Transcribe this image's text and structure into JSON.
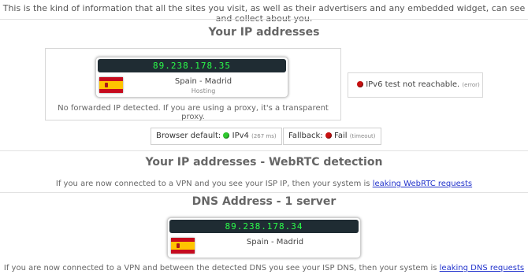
{
  "intro": "This is the kind of information that all the sites you visit, as well as their advertisers and any embedded widget, can see and collect about you.",
  "ip_section": {
    "title": "Your IP addresses",
    "ip": "89.238.178.35",
    "location": "Spain - Madrid",
    "type": "Hosting",
    "proxy_note": "No forwarded IP detected. If you are using a proxy, it's a transparent proxy.",
    "ipv6_text": "IPv6 test not reachable.",
    "ipv6_suffix": "(error)",
    "browser_default_label": "Browser default:",
    "browser_default_value": "IPv4",
    "browser_default_time": "(267 ms)",
    "fallback_label": "Fallback:",
    "fallback_value": "Fail",
    "fallback_time": "(timeout)"
  },
  "webrtc_section": {
    "title": "Your IP addresses - WebRTC detection",
    "text": "If you are now connected to a VPN and you see your ISP IP, then your system is",
    "link": "leaking WebRTC requests"
  },
  "dns_section": {
    "title": "DNS Address - 1 server",
    "ip": "89.238.178.34",
    "location": "Spain - Madrid",
    "text": "If you are now connected to a VPN and between the detected DNS you see your ISP DNS, then your system is",
    "link": "leaking DNS requests"
  },
  "colors": {
    "lcd_bg": "#1f2c33",
    "lcd_text": "#2bff4a",
    "status_red": "#c81010",
    "status_green": "#2fc82f",
    "link": "#2233cc"
  }
}
